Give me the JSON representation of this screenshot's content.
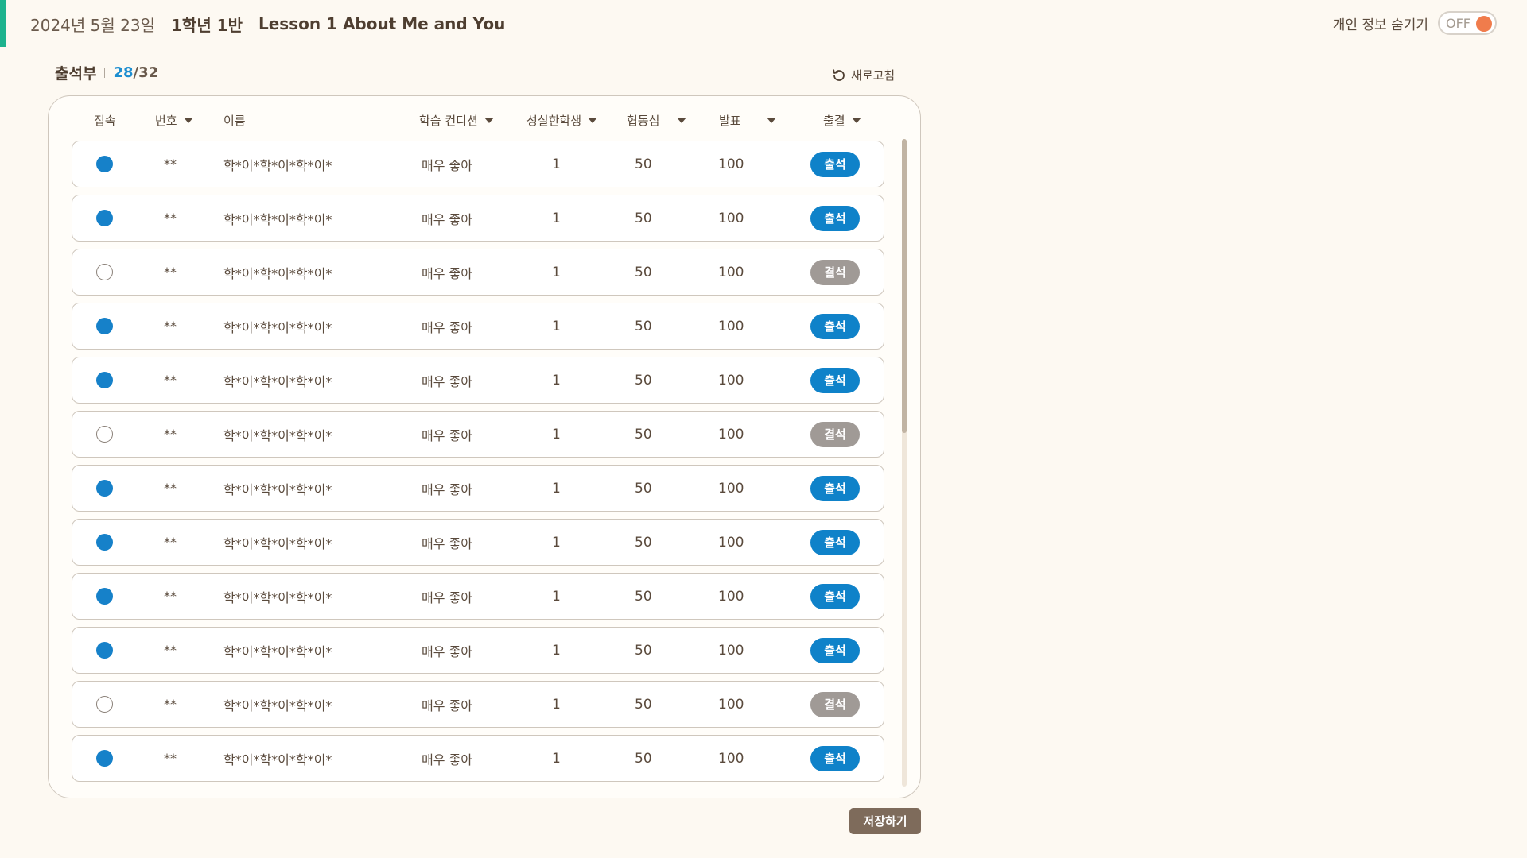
{
  "header": {
    "date": "2024년 5월 23일",
    "class_name": "1학년 1반",
    "lesson": "Lesson 1 About Me and You"
  },
  "privacy": {
    "label": "개인 정보 숨기기",
    "toggle_state": "OFF"
  },
  "section": {
    "title": "출석부",
    "count_current": "28",
    "count_slash": "/",
    "count_total": "32",
    "refresh_label": "새로고침"
  },
  "table": {
    "columns": [
      "접속",
      "번호",
      "이름",
      "학습 컨디션",
      "성실한학생",
      "협동심",
      "발표",
      "출결"
    ],
    "rows": [
      {
        "online": true,
        "number": "**",
        "name": "학*이*학*이*학*이*",
        "condition": "매우 좋아",
        "diligent": "1",
        "cooperation": "50",
        "presentation": "100",
        "attendance": "출석"
      },
      {
        "online": true,
        "number": "**",
        "name": "학*이*학*이*학*이*",
        "condition": "매우 좋아",
        "diligent": "1",
        "cooperation": "50",
        "presentation": "100",
        "attendance": "출석"
      },
      {
        "online": false,
        "number": "**",
        "name": "학*이*학*이*학*이*",
        "condition": "매우 좋아",
        "diligent": "1",
        "cooperation": "50",
        "presentation": "100",
        "attendance": "결석"
      },
      {
        "online": true,
        "number": "**",
        "name": "학*이*학*이*학*이*",
        "condition": "매우 좋아",
        "diligent": "1",
        "cooperation": "50",
        "presentation": "100",
        "attendance": "출석"
      },
      {
        "online": true,
        "number": "**",
        "name": "학*이*학*이*학*이*",
        "condition": "매우 좋아",
        "diligent": "1",
        "cooperation": "50",
        "presentation": "100",
        "attendance": "출석"
      },
      {
        "online": false,
        "number": "**",
        "name": "학*이*학*이*학*이*",
        "condition": "매우 좋아",
        "diligent": "1",
        "cooperation": "50",
        "presentation": "100",
        "attendance": "결석"
      },
      {
        "online": true,
        "number": "**",
        "name": "학*이*학*이*학*이*",
        "condition": "매우 좋아",
        "diligent": "1",
        "cooperation": "50",
        "presentation": "100",
        "attendance": "출석"
      },
      {
        "online": true,
        "number": "**",
        "name": "학*이*학*이*학*이*",
        "condition": "매우 좋아",
        "diligent": "1",
        "cooperation": "50",
        "presentation": "100",
        "attendance": "출석"
      },
      {
        "online": true,
        "number": "**",
        "name": "학*이*학*이*학*이*",
        "condition": "매우 좋아",
        "diligent": "1",
        "cooperation": "50",
        "presentation": "100",
        "attendance": "출석"
      },
      {
        "online": true,
        "number": "**",
        "name": "학*이*학*이*학*이*",
        "condition": "매우 좋아",
        "diligent": "1",
        "cooperation": "50",
        "presentation": "100",
        "attendance": "출석"
      },
      {
        "online": false,
        "number": "**",
        "name": "학*이*학*이*학*이*",
        "condition": "매우 좋아",
        "diligent": "1",
        "cooperation": "50",
        "presentation": "100",
        "attendance": "결석"
      },
      {
        "online": true,
        "number": "**",
        "name": "학*이*학*이*학*이*",
        "condition": "매우 좋아",
        "diligent": "1",
        "cooperation": "50",
        "presentation": "100",
        "attendance": "출석"
      }
    ]
  },
  "save_label": "저장하기",
  "colors": {
    "accent": "#1db38e",
    "present": "#0f82c9",
    "absent": "#a09a96",
    "online_dot": "#1681c9",
    "toggle_knob": "#f07c4c",
    "save_button": "#7e6b5b"
  }
}
